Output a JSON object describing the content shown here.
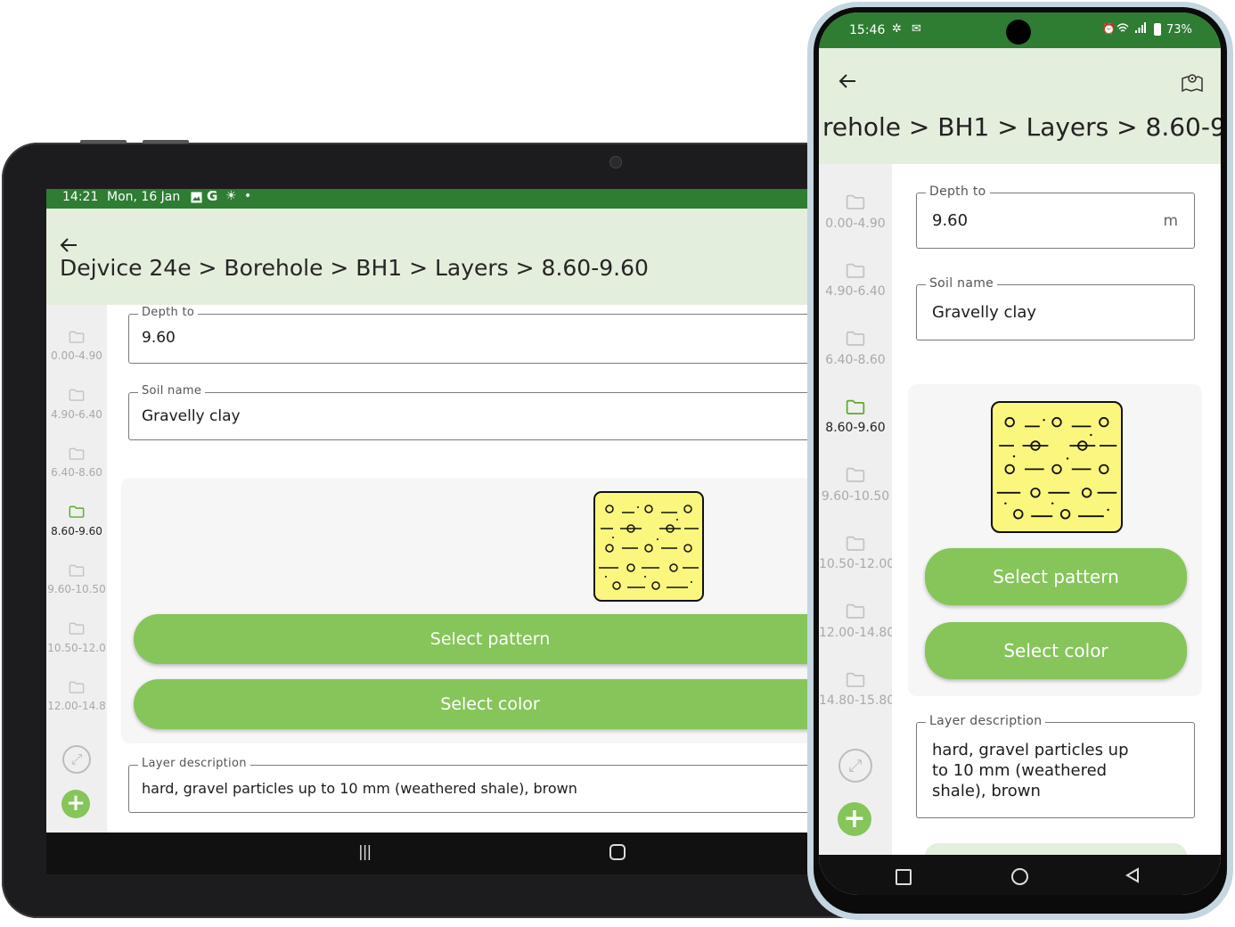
{
  "tablet": {
    "status": {
      "time": "14:21",
      "date": "Mon, 16 Jan",
      "icons": [
        "image-icon",
        "google-icon",
        "brightness-icon",
        "dot-icon"
      ]
    },
    "title": "Dejvice 24e > Borehole > BH1 > Layers > 8.60-9.60",
    "rail": [
      {
        "label": "0.00-4.90",
        "active": false
      },
      {
        "label": "4.90-6.40",
        "active": false
      },
      {
        "label": "6.40-8.60",
        "active": false
      },
      {
        "label": "8.60-9.60",
        "active": true
      },
      {
        "label": "9.60-10.50",
        "active": false
      },
      {
        "label": "10.50-12.0",
        "active": false
      },
      {
        "label": "12.00-14.8",
        "active": false
      }
    ],
    "form": {
      "depth_to_label": "Depth to",
      "depth_to_value": "9.60",
      "soil_name_label": "Soil name",
      "soil_name_value": "Gravelly clay",
      "select_pattern": "Select pattern",
      "select_color": "Select color",
      "layer_description_label": "Layer description",
      "layer_description_value": "hard, gravel particles up to 10 mm (weathered shale), brown"
    },
    "nav": {
      "recents": "|||",
      "home": "○"
    }
  },
  "phone": {
    "status": {
      "time": "15:46",
      "battery": "73%",
      "icons": [
        "fan-icon",
        "gmail-icon",
        "alarm-icon",
        "wifi-icon",
        "signal-icon",
        "battery-icon"
      ]
    },
    "title": "rehole > BH1 > Layers > 8.60-9.60",
    "rail": [
      {
        "label": "0.00-4.90",
        "active": false
      },
      {
        "label": "4.90-6.40",
        "active": false
      },
      {
        "label": "6.40-8.60",
        "active": false
      },
      {
        "label": "8.60-9.60",
        "active": true
      },
      {
        "label": "9.60-10.50",
        "active": false
      },
      {
        "label": "10.50-12.00",
        "active": false
      },
      {
        "label": "12.00-14.80",
        "active": false
      },
      {
        "label": "14.80-15.80",
        "active": false
      }
    ],
    "form": {
      "depth_to_label": "Depth to",
      "depth_to_value": "9.60",
      "depth_unit": "m",
      "soil_name_label": "Soil name",
      "soil_name_value": "Gravelly clay",
      "select_pattern": "Select pattern",
      "select_color": "Select color",
      "layer_description_label": "Layer description",
      "layer_description_value": "hard, gravel particles up to 10 mm (weathered shale), brown"
    }
  },
  "colors": {
    "status_bar": "#2e7d32",
    "app_bar": "#e4eedc",
    "accent": "#86c55a",
    "pattern_fill": "#fbf67d"
  }
}
